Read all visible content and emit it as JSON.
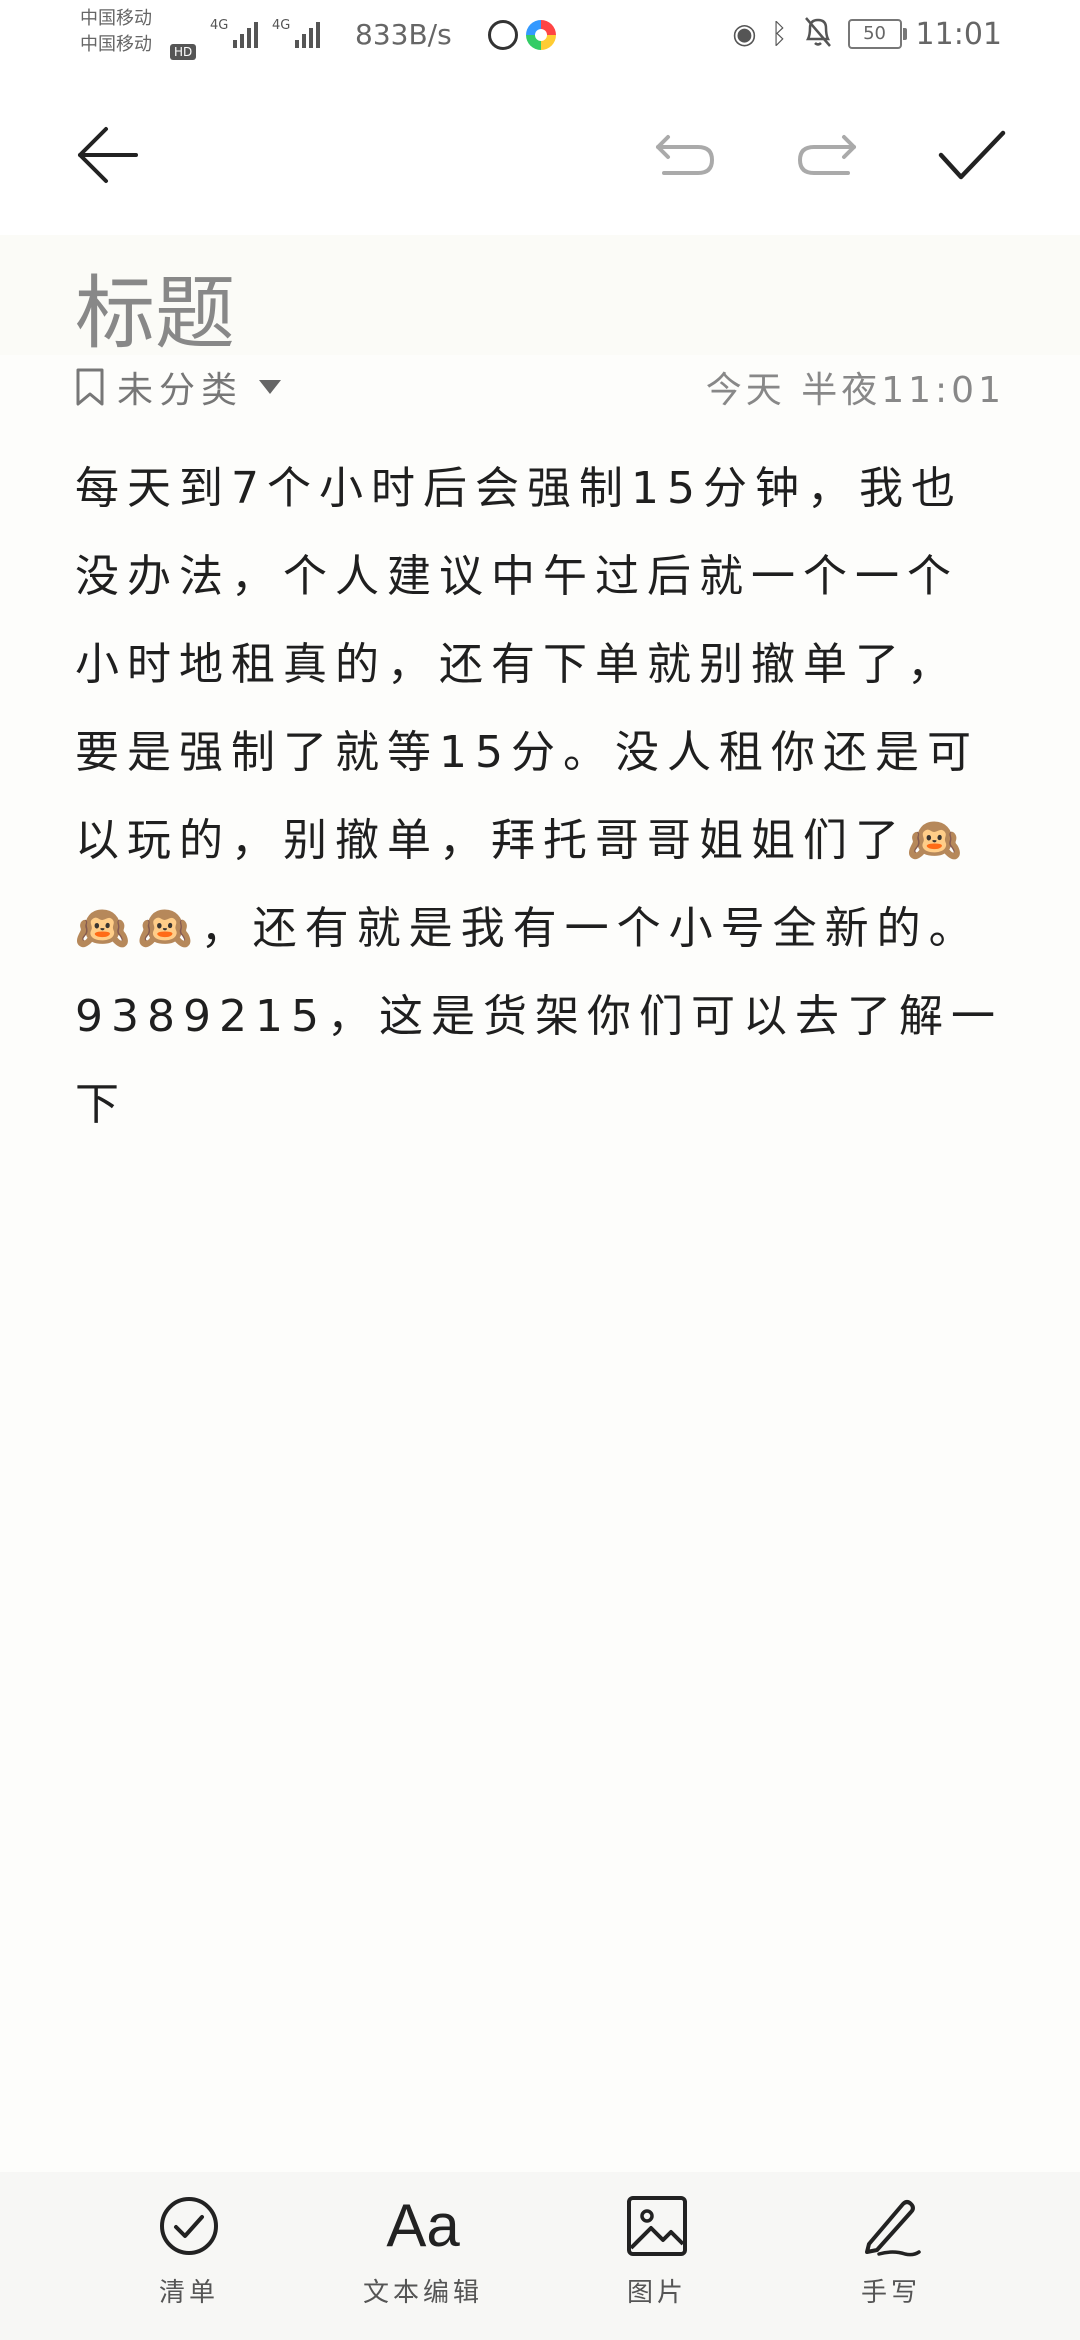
{
  "status_bar": {
    "carrier_1": "中国移动",
    "carrier_2": "中国移动",
    "hd_badge": "HD",
    "network_1": "4G",
    "network_2": "4G",
    "speed": "833B/s",
    "battery": "50",
    "time": "11:01"
  },
  "note": {
    "title_placeholder": "标题",
    "category": "未分类",
    "date": "今天 半夜11:01",
    "body": "每天到7个小时后会强制15分钟，我也没办法，个人建议中午过后就一个一个小时地租真的，还有下单就别撤单了，要是强制了就等15分。没人租你还是可以玩的，别撤单，拜托哥哥姐姐们了🙉🙉🙉，还有就是我有一个小号全新的。9389215，这是货架你们可以去了解一下"
  },
  "bottom_bar": {
    "checklist_label": "清单",
    "textedit_glyph": "Aa",
    "textedit_label": "文本编辑",
    "image_label": "图片",
    "handwrite_label": "手写"
  },
  "icons": {
    "back": "arrow-left-icon",
    "undo": "undo-icon",
    "redo": "redo-icon",
    "done": "checkmark-icon",
    "category": "bookmark-icon",
    "checklist": "check-circle-icon",
    "image": "image-icon",
    "handwrite": "pen-icon"
  },
  "colors": {
    "background": "#fdfdfb",
    "text": "#1f1f1f",
    "muted": "#888888"
  }
}
